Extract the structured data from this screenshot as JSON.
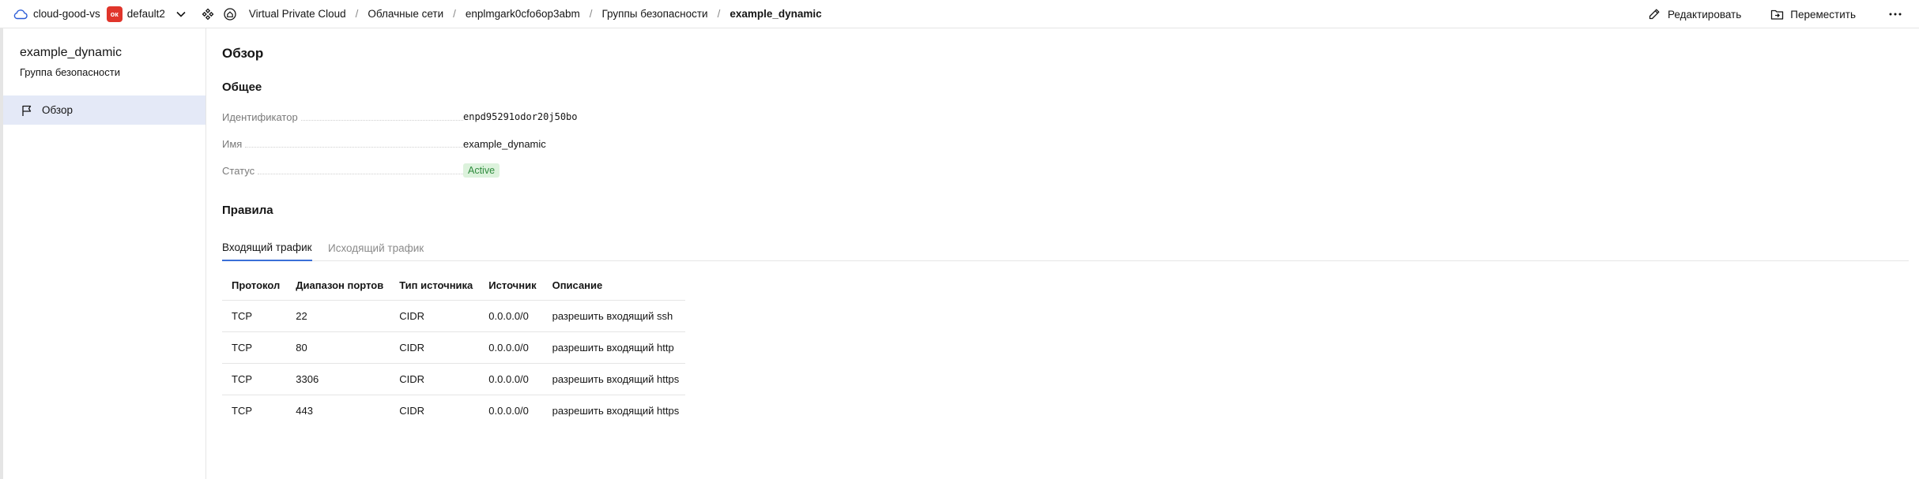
{
  "topbar": {
    "cloud_name": "cloud-good-vs",
    "folder_badge": "ок",
    "folder_name": "default2",
    "breadcrumbs": [
      {
        "label": "Virtual Private Cloud"
      },
      {
        "label": "Облачные сети"
      },
      {
        "label": "enplmgark0cfo6op3abm"
      },
      {
        "label": "Группы безопасности"
      },
      {
        "label": "example_dynamic"
      }
    ],
    "actions": {
      "edit_label": "Редактировать",
      "move_label": "Переместить"
    },
    "more_icon": "ellipsis-icon"
  },
  "sidebar": {
    "title": "example_dynamic",
    "subtitle": "Группа безопасности",
    "items": [
      {
        "label": "Обзор",
        "icon": "flag-icon",
        "active": true
      }
    ]
  },
  "main": {
    "page_title": "Обзор",
    "general_title": "Общее",
    "properties": [
      {
        "label": "Идентификатор",
        "value": "enpd95291odor20j50bo"
      },
      {
        "label": "Имя",
        "value": "example_dynamic"
      },
      {
        "label": "Статус",
        "value": "Active"
      }
    ],
    "rules_title": "Правила",
    "tabs": [
      {
        "label": "Входящий трафик",
        "active": true
      },
      {
        "label": "Исходящий трафик",
        "active": false
      }
    ],
    "table": {
      "headers": [
        "Протокол",
        "Диапазон портов",
        "Тип источника",
        "Источник",
        "Описание"
      ],
      "rows": [
        [
          "TCP",
          "22",
          "CIDR",
          "0.0.0.0/0",
          "разрешить входящий ssh"
        ],
        [
          "TCP",
          "80",
          "CIDR",
          "0.0.0.0/0",
          "разрешить входящий http"
        ],
        [
          "TCP",
          "3306",
          "CIDR",
          "0.0.0.0/0",
          "разрешить входящий https"
        ],
        [
          "TCP",
          "443",
          "CIDR",
          "0.0.0.0/0",
          "разрешить входящий https"
        ]
      ]
    }
  },
  "colors": {
    "accent": "#3a6fd8",
    "folder_badge": "#e0352b",
    "sidebar_active": "#e4e9f7",
    "status_bg": "#dcf2dc",
    "status_text": "#2e8b3d"
  }
}
